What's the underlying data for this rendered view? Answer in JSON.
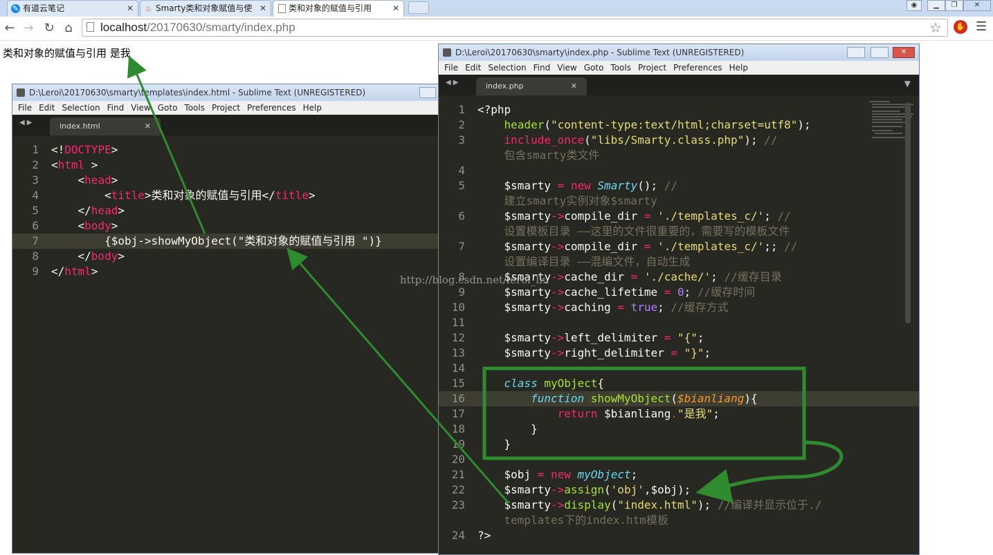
{
  "browser": {
    "tabs": [
      {
        "label": "有道云笔记",
        "icon": "youdao-note-icon"
      },
      {
        "label": "Smarty类和对象赋值与使",
        "icon": "flame-icon"
      },
      {
        "label": "类和对象的赋值与引用",
        "icon": "page-icon"
      }
    ],
    "url_host": "localhost",
    "url_path": "/20170630/smarty/index.php"
  },
  "page": {
    "output_text": "类和对象的赋值与引用 是我"
  },
  "left_window": {
    "title": "D:\\Leroi\\20170630\\smarty\\templates\\index.html - Sublime Text (UNREGISTERED)",
    "menu": [
      "File",
      "Edit",
      "Selection",
      "Find",
      "View",
      "Goto",
      "Tools",
      "Project",
      "Preferences",
      "Help"
    ],
    "tab": "index.html"
  },
  "right_window": {
    "title": "D:\\Leroi\\20170630\\smarty\\index.php - Sublime Text (UNREGISTERED)",
    "menu": [
      "File",
      "Edit",
      "Selection",
      "Find",
      "View",
      "Goto",
      "Tools",
      "Project",
      "Preferences",
      "Help"
    ],
    "tab": "index.php"
  },
  "watermark": "http://blog.csdn.net/leroi_liu",
  "colors": {
    "editor_bg": "#272822",
    "annotation": "#2e8b2e"
  },
  "left_code": [
    {
      "n": "1",
      "tokens": [
        [
          "",
          "<!"
        ],
        [
          "kw",
          "DOCTYPE"
        ],
        [
          "",
          ">"
        ]
      ]
    },
    {
      "n": "2",
      "tokens": [
        [
          "",
          "<"
        ],
        [
          "kw",
          "html"
        ],
        [
          "",
          " >"
        ]
      ]
    },
    {
      "n": "3",
      "tokens": [
        [
          "",
          "    <"
        ],
        [
          "kw",
          "head"
        ],
        [
          "",
          ">"
        ]
      ]
    },
    {
      "n": "4",
      "tokens": [
        [
          "",
          "        <"
        ],
        [
          "kw",
          "title"
        ],
        [
          "",
          ">类和对象的赋值与引用</"
        ],
        [
          "kw",
          "title"
        ],
        [
          "",
          ">"
        ]
      ]
    },
    {
      "n": "5",
      "tokens": [
        [
          "",
          "    </"
        ],
        [
          "kw",
          "head"
        ],
        [
          "",
          ">"
        ]
      ]
    },
    {
      "n": "6",
      "tokens": [
        [
          "",
          "    <"
        ],
        [
          "kw",
          "body"
        ],
        [
          "",
          ">"
        ]
      ]
    },
    {
      "n": "7",
      "cur": true,
      "tokens": [
        [
          "",
          "        {$obj->showMyObject(\"类和对象的赋值与引用 \")}"
        ]
      ]
    },
    {
      "n": "8",
      "tokens": [
        [
          "",
          "    </"
        ],
        [
          "kw",
          "body"
        ],
        [
          "",
          ">"
        ]
      ]
    },
    {
      "n": "9",
      "tokens": [
        [
          "",
          "</"
        ],
        [
          "kw",
          "html"
        ],
        [
          "",
          ">"
        ]
      ]
    }
  ],
  "right_code": [
    {
      "n": "1",
      "tokens": [
        [
          "",
          "<?php"
        ]
      ]
    },
    {
      "n": "2",
      "tokens": [
        [
          "",
          "    "
        ],
        [
          "ty2",
          "header"
        ],
        [
          "",
          "("
        ],
        [
          "st",
          "\"content-type:text/html;charset=utf8\""
        ],
        [
          "",
          ");"
        ]
      ]
    },
    {
      "n": "3",
      "tokens": [
        [
          "",
          "    "
        ],
        [
          "kw",
          "include_once"
        ],
        [
          "",
          "("
        ],
        [
          "st",
          "\"libs/Smarty.class.php\""
        ],
        [
          "",
          "); "
        ],
        [
          "cm",
          "//"
        ]
      ]
    },
    {
      "n": "",
      "tokens": [
        [
          "cm",
          "    包含smarty类文件"
        ]
      ]
    },
    {
      "n": "4",
      "tokens": []
    },
    {
      "n": "5",
      "tokens": [
        [
          "",
          "    $smarty "
        ],
        [
          "kw",
          "="
        ],
        [
          "",
          " "
        ],
        [
          "kw",
          "new"
        ],
        [
          "",
          " "
        ],
        [
          "ty",
          "Smarty"
        ],
        [
          "",
          "(); "
        ],
        [
          "cm",
          "//"
        ]
      ]
    },
    {
      "n": "",
      "tokens": [
        [
          "cm",
          "    建立smarty实例对象$smarty"
        ]
      ]
    },
    {
      "n": "6",
      "tokens": [
        [
          "",
          "    $smarty"
        ],
        [
          "kw",
          "->"
        ],
        [
          "",
          "compile_dir "
        ],
        [
          "kw",
          "="
        ],
        [
          "",
          " "
        ],
        [
          "st",
          "'./templates_c/'"
        ],
        [
          "",
          "; "
        ],
        [
          "cm",
          "//"
        ]
      ]
    },
    {
      "n": "",
      "tokens": [
        [
          "cm",
          "    设置模板目录 ——这里的文件很重要的，需要写的模板文件"
        ]
      ]
    },
    {
      "n": "7",
      "tokens": [
        [
          "",
          "    $smarty"
        ],
        [
          "kw",
          "->"
        ],
        [
          "",
          "compile_dir "
        ],
        [
          "kw",
          "="
        ],
        [
          "",
          " "
        ],
        [
          "st",
          "'./templates_c/'"
        ],
        [
          "",
          ";; "
        ],
        [
          "cm",
          "//"
        ]
      ]
    },
    {
      "n": "",
      "tokens": [
        [
          "cm",
          "    设置编译目录 ——混编文件，自动生成"
        ]
      ]
    },
    {
      "n": "8",
      "tokens": [
        [
          "",
          "    $smarty"
        ],
        [
          "kw",
          "->"
        ],
        [
          "",
          "cache_dir "
        ],
        [
          "kw",
          "="
        ],
        [
          "",
          " "
        ],
        [
          "st",
          "'./cache/'"
        ],
        [
          "",
          "; "
        ],
        [
          "cm",
          "//缓存目录"
        ]
      ]
    },
    {
      "n": "9",
      "tokens": [
        [
          "",
          "    $smarty"
        ],
        [
          "kw",
          "->"
        ],
        [
          "",
          "cache_lifetime "
        ],
        [
          "kw",
          "="
        ],
        [
          "",
          " "
        ],
        [
          "cn",
          "0"
        ],
        [
          "",
          "; "
        ],
        [
          "cm",
          "//缓存时间"
        ]
      ]
    },
    {
      "n": "10",
      "tokens": [
        [
          "",
          "    $smarty"
        ],
        [
          "kw",
          "->"
        ],
        [
          "",
          "caching "
        ],
        [
          "kw",
          "="
        ],
        [
          "",
          " "
        ],
        [
          "cn",
          "true"
        ],
        [
          "",
          "; "
        ],
        [
          "cm",
          "//缓存方式"
        ]
      ]
    },
    {
      "n": "11",
      "tokens": []
    },
    {
      "n": "12",
      "tokens": [
        [
          "",
          "    $smarty"
        ],
        [
          "kw",
          "->"
        ],
        [
          "",
          "left_delimiter "
        ],
        [
          "kw",
          "="
        ],
        [
          "",
          " "
        ],
        [
          "st",
          "\"{\""
        ],
        [
          "",
          ";"
        ]
      ]
    },
    {
      "n": "13",
      "tokens": [
        [
          "",
          "    $smarty"
        ],
        [
          "kw",
          "->"
        ],
        [
          "",
          "right_delimiter "
        ],
        [
          "kw",
          "="
        ],
        [
          "",
          " "
        ],
        [
          "st",
          "\"}\""
        ],
        [
          "",
          ";"
        ]
      ]
    },
    {
      "n": "14",
      "tokens": []
    },
    {
      "n": "15",
      "tokens": [
        [
          "",
          "    "
        ],
        [
          "ty",
          "class"
        ],
        [
          "",
          " "
        ],
        [
          "fn",
          "myObject"
        ],
        [
          "",
          "{"
        ]
      ]
    },
    {
      "n": "16",
      "cur": true,
      "tokens": [
        [
          "",
          "        "
        ],
        [
          "ty",
          "function"
        ],
        [
          "",
          " "
        ],
        [
          "fn",
          "showMyObject"
        ],
        [
          "",
          "("
        ],
        [
          "pr",
          "$bianliang"
        ],
        [
          "",
          "){"
        ]
      ]
    },
    {
      "n": "17",
      "tokens": [
        [
          "",
          "            "
        ],
        [
          "kw",
          "return"
        ],
        [
          "",
          " $bianliang"
        ],
        [
          "kw",
          "."
        ],
        [
          "st",
          "\"是我\""
        ],
        [
          "",
          ";"
        ]
      ]
    },
    {
      "n": "18",
      "tokens": [
        [
          "",
          "        }"
        ]
      ]
    },
    {
      "n": "19",
      "tokens": [
        [
          "",
          "    }"
        ]
      ]
    },
    {
      "n": "20",
      "tokens": []
    },
    {
      "n": "21",
      "tokens": [
        [
          "",
          "    $obj "
        ],
        [
          "kw",
          "="
        ],
        [
          "",
          " "
        ],
        [
          "kw",
          "new"
        ],
        [
          "",
          " "
        ],
        [
          "ty",
          "myObject"
        ],
        [
          "",
          ";"
        ]
      ]
    },
    {
      "n": "22",
      "tokens": [
        [
          "",
          "    $smarty"
        ],
        [
          "kw",
          "->"
        ],
        [
          "ty2",
          "assign"
        ],
        [
          "",
          "("
        ],
        [
          "st",
          "'obj'"
        ],
        [
          "",
          ",$obj);"
        ]
      ]
    },
    {
      "n": "23",
      "tokens": [
        [
          "",
          "    $smarty"
        ],
        [
          "kw",
          "->"
        ],
        [
          "ty2",
          "display"
        ],
        [
          "",
          "("
        ],
        [
          "st",
          "\"index.html\""
        ],
        [
          "",
          "); "
        ],
        [
          "cm",
          "//编译并显示位于./"
        ]
      ]
    },
    {
      "n": "",
      "tokens": [
        [
          "cm",
          "    templates下的index.htm模板"
        ]
      ]
    },
    {
      "n": "24",
      "tokens": [
        [
          "",
          "?>"
        ]
      ]
    }
  ]
}
